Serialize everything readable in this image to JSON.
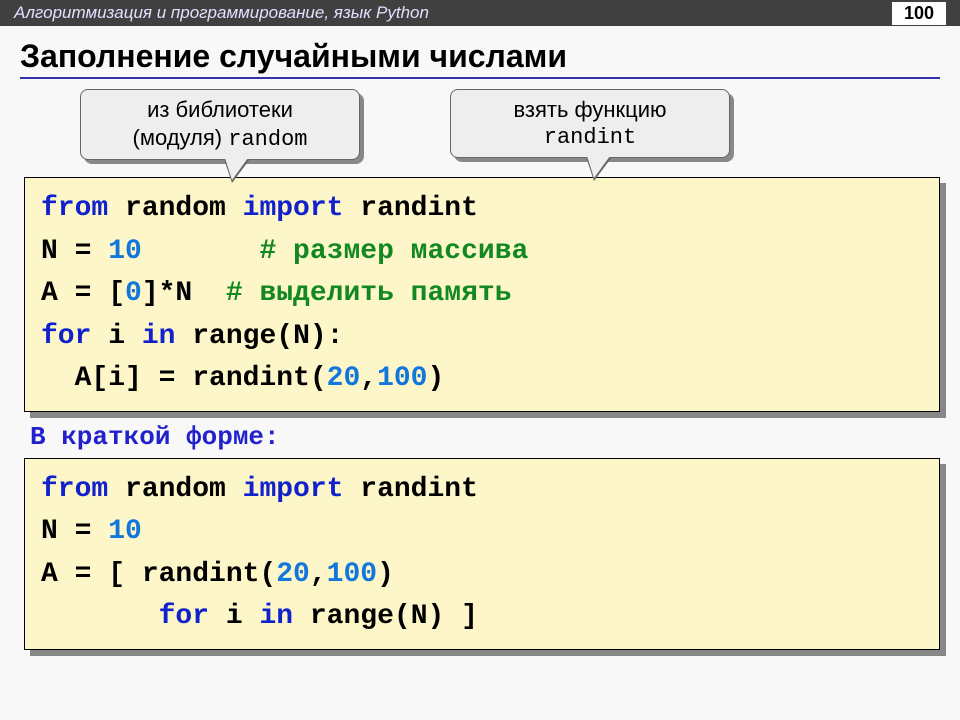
{
  "header": {
    "title": "Алгоритмизация и программирование, язык Python",
    "page": "100"
  },
  "title": "Заполнение случайными числами",
  "callout1": {
    "line1": "из библиотеки",
    "line2_a": "(модуля)",
    "line2_b": "random"
  },
  "callout2": {
    "line1": "взять функцию",
    "line2": "randint"
  },
  "code1": {
    "l1_kw1": "from ",
    "l1_t1": "random ",
    "l1_kw2": "import ",
    "l1_t2": "randint",
    "l2_a": "N = ",
    "l2_n": "10",
    "l2_sp": "       ",
    "l2_c": "# размер массива",
    "l3_a": "A = [",
    "l3_n": "0",
    "l3_b": "]*N  ",
    "l3_c": "# выделить память",
    "l4_kw1": "for ",
    "l4_a": "i ",
    "l4_kw2": "in ",
    "l4_b": "range(N):",
    "l5_a": "  A[i] = randint(",
    "l5_n1": "20",
    "l5_comma": ",",
    "l5_n2": "100",
    "l5_b": ")"
  },
  "subheader": "В краткой форме:",
  "code2": {
    "l1_kw1": "from ",
    "l1_t1": "random ",
    "l1_kw2": "import ",
    "l1_t2": "randint",
    "l2_a": "N = ",
    "l2_n": "10",
    "l3_a": "A = [ randint(",
    "l3_n1": "20",
    "l3_comma": ",",
    "l3_n2": "100",
    "l3_b": ") ",
    "l4_sp": "       ",
    "l4_kw1": "for ",
    "l4_a": "i ",
    "l4_kw2": "in ",
    "l4_b": "range(N) ]"
  }
}
